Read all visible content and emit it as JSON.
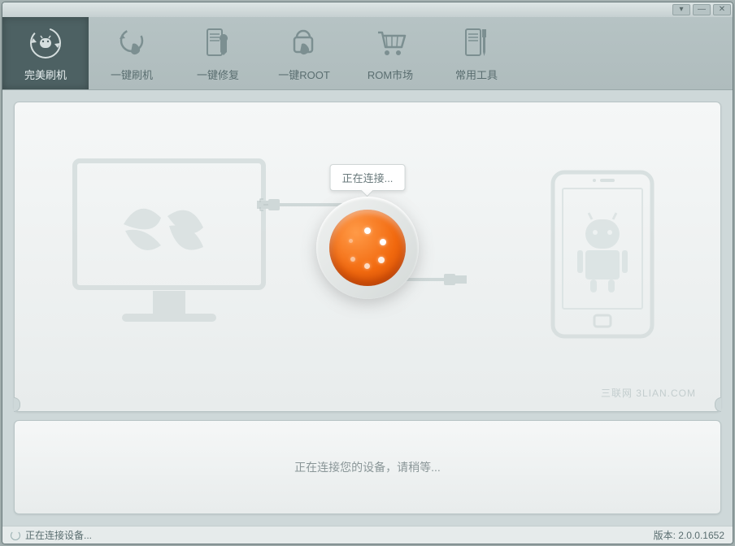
{
  "toolbar": {
    "items": [
      {
        "label": "完美刷机"
      },
      {
        "label": "一键刷机"
      },
      {
        "label": "一键修复"
      },
      {
        "label": "一键ROOT"
      },
      {
        "label": "ROM市场"
      },
      {
        "label": "常用工具"
      }
    ]
  },
  "connect": {
    "tooltip": "正在连接...",
    "message": "正在连接您的设备，请稍等..."
  },
  "watermark": "三联网 3LIAN.COM",
  "status": {
    "text": "正在连接设备...",
    "version_label": "版本:",
    "version": "2.0.0.1652"
  },
  "colors": {
    "accent": "#f26a0f",
    "toolbar_active": "#4d6163"
  }
}
